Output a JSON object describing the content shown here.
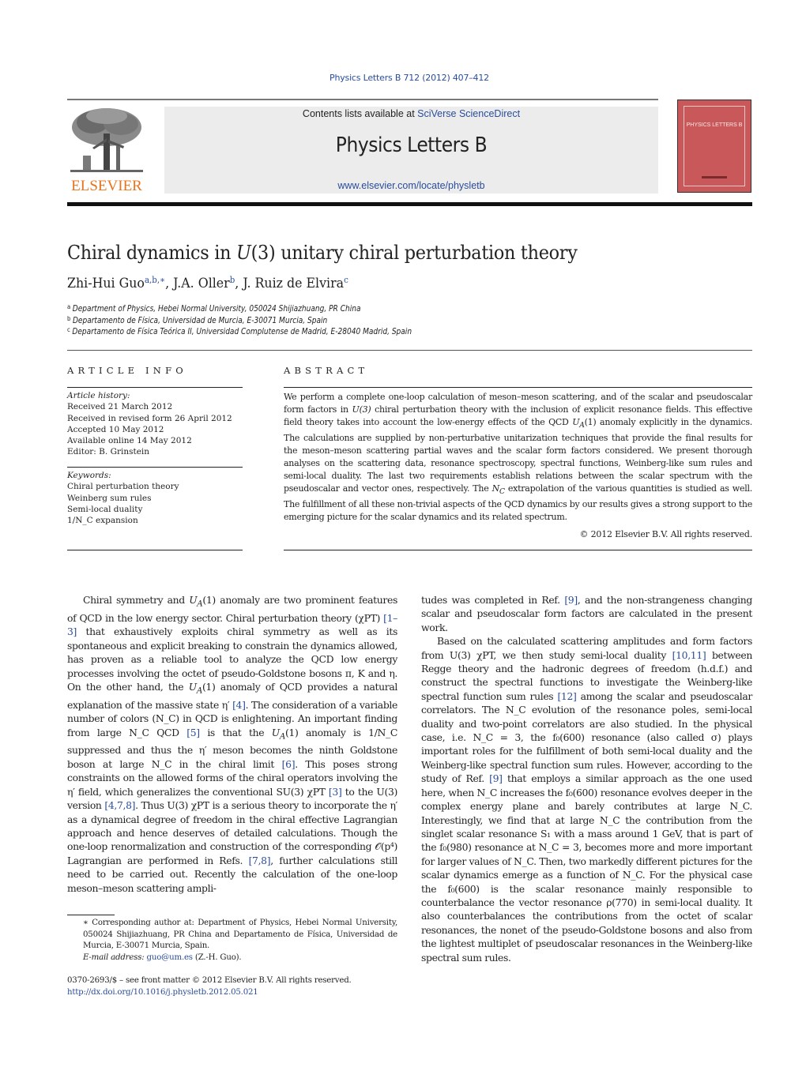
{
  "journal_ref": "Physics Letters B 712 (2012) 407–412",
  "header": {
    "contents_prefix": "Contents lists available at ",
    "contents_link": "SciVerse ScienceDirect",
    "journal_title": "Physics Letters B",
    "journal_url": "www.elsevier.com/locate/physletb",
    "publisher_logo_text": "ELSEVIER",
    "cover_title": "PHYSICS LETTERS B",
    "colors": {
      "link": "#2a4d9b",
      "elsevier_orange": "#e8731c",
      "cover_red": "#c8585a",
      "banner_bg": "#ececec"
    }
  },
  "article": {
    "title_prefix": "Chiral dynamics in ",
    "title_math": "U",
    "title_math_arg": "(3)",
    "title_suffix": " unitary chiral perturbation theory",
    "authors": [
      {
        "name": "Zhi-Hui Guo",
        "affil": "a,b,∗",
        "sep": ", "
      },
      {
        "name": "J.A. Oller",
        "affil": "b",
        "sep": ", "
      },
      {
        "name": "J. Ruiz de Elvira",
        "affil": "c",
        "sep": ""
      }
    ],
    "affiliations": [
      {
        "key": "a",
        "text": "Department of Physics, Hebei Normal University, 050024 Shijiazhuang, PR China"
      },
      {
        "key": "b",
        "text": "Departamento de Física, Universidad de Murcia, E-30071 Murcia, Spain"
      },
      {
        "key": "c",
        "text": "Departamento de Física Teórica II, Universidad Complutense de Madrid, E-28040 Madrid, Spain"
      }
    ]
  },
  "article_info": {
    "heading": "ARTICLE INFO",
    "history_label": "Article history:",
    "history": [
      "Received 21 March 2012",
      "Received in revised form 26 April 2012",
      "Accepted 10 May 2012",
      "Available online 14 May 2012",
      "Editor: B. Grinstein"
    ],
    "keywords_label": "Keywords:",
    "keywords": [
      "Chiral perturbation theory",
      "Weinberg sum rules",
      "Semi-local duality",
      "1/N_C expansion"
    ]
  },
  "abstract": {
    "heading": "ABSTRACT",
    "text_1": "We perform a complete one-loop calculation of meson–meson scattering, and of the scalar and pseudoscalar form factors in ",
    "text_2": " chiral perturbation theory with the inclusion of explicit resonance fields. This effective field theory takes into account the low-energy effects of the QCD ",
    "text_3": " anomaly explicitly in the dynamics. The calculations are supplied by non-perturbative unitarization techniques that provide the final results for the meson–meson scattering partial waves and the scalar form factors considered. We present thorough analyses on the scattering data, resonance spectroscopy, spectral functions, Weinberg-like sum rules and semi-local duality. The last two requirements establish relations between the scalar spectrum with the pseudoscalar and vector ones, respectively. The ",
    "text_4": " extrapolation of the various quantities is studied as well. The fulfillment of all these non-trivial aspects of the QCD dynamics by our results gives a strong support to the emerging picture for the scalar dynamics and its related spectrum.",
    "copyright": "© 2012 Elsevier B.V. All rights reserved."
  },
  "body": {
    "left": {
      "p1_a": "Chiral symmetry and ",
      "p1_b": " anomaly are two prominent features of QCD in the low energy sector. Chiral perturbation theory (χPT) ",
      "ref_1": "[1–3]",
      "p1_c": " that exhaustively exploits chiral symmetry as well as its spontaneous and explicit breaking to constrain the dynamics allowed, has proven as a reliable tool to analyze the QCD low energy processes involving the octet of pseudo-Goldstone bosons π, K and η. On the other hand, the ",
      "p1_d": " anomaly of QCD provides a natural explanation of the massive state η′ ",
      "ref_2": "[4]",
      "p1_e": ". The consideration of a variable number of colors (N_C) in QCD is enlightening. An important finding from large N_C QCD ",
      "ref_3": "[5]",
      "p1_f": " is that the ",
      "p1_g": " anomaly is 1/N_C suppressed and thus the η′ meson becomes the ninth Goldstone boson at large N_C in the chiral limit ",
      "ref_4": "[6]",
      "p1_h": ". This poses strong constraints on the allowed forms of the chiral operators involving the η′ field, which generalizes the conventional SU(3) χPT ",
      "ref_5": "[3]",
      "p1_i": " to the U(3) version ",
      "ref_6": "[4,7,8]",
      "p1_j": ". Thus U(3) χPT is a serious theory to incorporate the η′ as a dynamical degree of freedom in the chiral effective Lagrangian approach and hence deserves of detailed calculations. Though the one-loop renormalization and construction of the corresponding 𝒪(p⁴) Lagrangian are performed in Refs. ",
      "ref_7": "[7,8]",
      "p1_k": ", further calculations still need to be carried out. Recently the calculation of the one-loop meson–meson scattering ampli-"
    },
    "right": {
      "p1_a": "tudes was completed in Ref. ",
      "ref_1": "[9]",
      "p1_b": ", and the non-strangeness changing scalar and pseudoscalar form factors are calculated in the present work.",
      "p2_a": "Based on the calculated scattering amplitudes and form factors from U(3) χPT, we then study semi-local duality ",
      "ref_2": "[10,11]",
      "p2_b": " between Regge theory and the hadronic degrees of freedom (h.d.f.) and construct the spectral functions to investigate the Weinberg-like spectral function sum rules ",
      "ref_3": "[12]",
      "p2_c": " among the scalar and pseudoscalar correlators. The N_C evolution of the resonance poles, semi-local duality and two-point correlators are also studied. In the physical case, i.e. N_C = 3, the f₀(600) resonance (also called σ) plays important roles for the fulfillment of both semi-local duality and the Weinberg-like spectral function sum rules. However, according to the study of Ref. ",
      "ref_4": "[9]",
      "p2_d": " that employs a similar approach as the one used here, when N_C increases the f₀(600) resonance evolves deeper in the complex energy plane and barely contributes at large N_C. Interestingly, we find that at large N_C the contribution from the singlet scalar resonance S₁ with a mass around 1 GeV, that is part of the f₀(980) resonance at N_C = 3, becomes more and more important for larger values of N_C. Then, two markedly different pictures for the scalar dynamics emerge as a function of N_C. For the physical case the f₀(600) is the scalar resonance mainly responsible to counterbalance the vector resonance ρ(770) in semi-local duality. It also counterbalances the contributions from the octet of scalar resonances, the nonet of the pseudo-Goldstone bosons and also from the lightest multiplet of pseudoscalar resonances in the Weinberg-like spectral sum rules."
    }
  },
  "footnote": {
    "marker": "∗",
    "text": " Corresponding author at: Department of Physics, Hebei Normal University, 050024 Shijiazhuang, PR China and Departamento de Física, Universidad de Murcia, E-30071 Murcia, Spain.",
    "email_label": "E-mail address:",
    "email": "guo@um.es",
    "email_suffix": " (Z.-H. Guo)."
  },
  "front_matter": {
    "issn_line": "0370-2693/$ – see front matter  © 2012 Elsevier B.V. All rights reserved.",
    "doi": "http://dx.doi.org/10.1016/j.physletb.2012.05.021"
  },
  "math": {
    "UA1_base": "U",
    "UA1_sub": "A",
    "UA1_arg": "(1)",
    "U3": "U(3)",
    "NC_base": "N",
    "NC_sub": "C"
  }
}
